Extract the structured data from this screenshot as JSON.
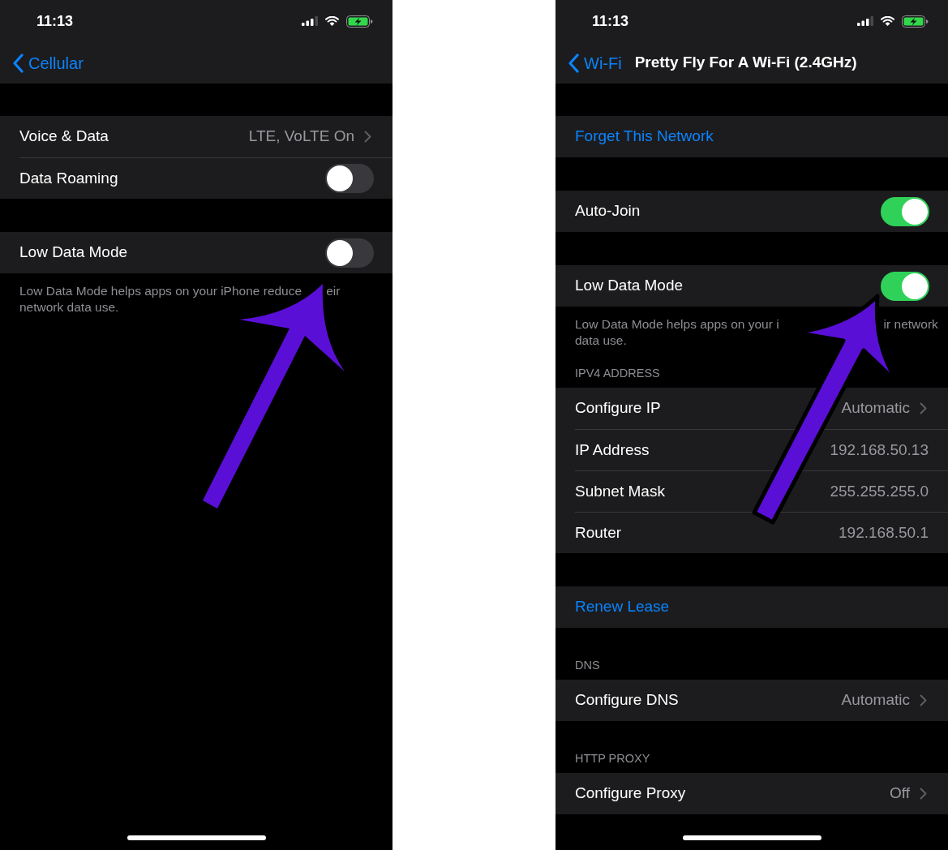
{
  "screens": [
    {
      "status_bar": {
        "time": "11:13"
      },
      "nav": {
        "back": "Cellular"
      },
      "sections": [
        {
          "rows": [
            {
              "kind": "detail",
              "label": "Voice & Data",
              "value": "LTE, VoLTE On"
            },
            {
              "kind": "toggle",
              "label": "Data Roaming",
              "on": false
            }
          ]
        },
        {
          "rows": [
            {
              "kind": "toggle",
              "label": "Low Data Mode",
              "on": false
            }
          ],
          "footer": [
            [
              "Low Data Mode helps apps on your iPhone reduce",
              "eir"
            ],
            [
              "network data use."
            ]
          ]
        }
      ]
    },
    {
      "status_bar": {
        "time": "11:13"
      },
      "nav": {
        "back": "Wi-Fi",
        "title": "Pretty Fly For A Wi-Fi (2.4GHz)"
      },
      "sections": [
        {
          "rows": [
            {
              "kind": "action",
              "label": "Forget This Network"
            }
          ]
        },
        {
          "rows": [
            {
              "kind": "toggle",
              "label": "Auto-Join",
              "on": true
            }
          ]
        },
        {
          "rows": [
            {
              "kind": "toggle",
              "label": "Low Data Mode",
              "on": true
            }
          ],
          "footer": [
            [
              "Low Data Mode helps apps on your i",
              "ir network"
            ],
            [
              "data use."
            ]
          ]
        },
        {
          "header": "IPV4 ADDRESS",
          "rows": [
            {
              "kind": "detail",
              "label": "Configure IP",
              "value": "Automatic"
            },
            {
              "kind": "info",
              "label": "IP Address",
              "value": "192.168.50.13"
            },
            {
              "kind": "info",
              "label": "Subnet Mask",
              "value": "255.255.255.0"
            },
            {
              "kind": "info",
              "label": "Router",
              "value": "192.168.50.1"
            }
          ]
        },
        {
          "rows": [
            {
              "kind": "action",
              "label": "Renew Lease"
            }
          ]
        },
        {
          "header": "DNS",
          "rows": [
            {
              "kind": "detail",
              "label": "Configure DNS",
              "value": "Automatic"
            }
          ]
        },
        {
          "header": "HTTP PROXY",
          "rows": [
            {
              "kind": "detail",
              "label": "Configure Proxy",
              "value": "Off"
            }
          ]
        }
      ]
    }
  ]
}
